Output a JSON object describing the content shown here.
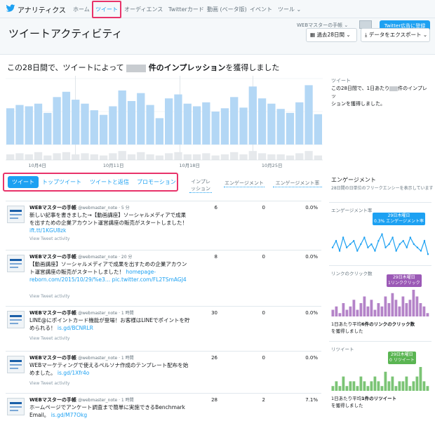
{
  "nav": {
    "app_name": "アナリティクス",
    "items": [
      "ホーム",
      "ツイート",
      "オーディエンス",
      "Twitterカード",
      "動画 (ベータ版)",
      "イベント",
      "ツール"
    ],
    "active": "ツイート"
  },
  "header": {
    "title": "ツイートアクティビティ",
    "account": "WEBマスターの手帳",
    "ads_button": "Twitter広告に登録",
    "date_range": "過去28日間",
    "export_button": "データをエクスポート"
  },
  "headline": {
    "prefix": "この28日間で、ツイートによって",
    "suffix_bold": "件のインプレッション",
    "suffix": "を獲得しました"
  },
  "sidebar_tweets": {
    "label": "ツイート",
    "line1": "この28日間で、1日あたり",
    "line1b": "件のインプレッ",
    "line2": "ションを獲得しました。"
  },
  "chart_data": {
    "type": "bar",
    "x_tick_labels": [
      "10月4日",
      "10月11日",
      "10月18日",
      "10月25日"
    ],
    "values": [
      55,
      60,
      58,
      62,
      48,
      72,
      80,
      68,
      62,
      52,
      45,
      58,
      82,
      66,
      78,
      60,
      40,
      70,
      76,
      62,
      58,
      64,
      50,
      55,
      72,
      56,
      88,
      70,
      62,
      54,
      48,
      64,
      90,
      46
    ],
    "secondary_values": [
      10,
      12,
      10,
      14,
      8,
      12,
      14,
      10,
      12,
      10,
      8,
      12,
      16,
      10,
      14,
      10,
      8,
      12,
      14,
      10,
      10,
      12,
      8,
      10,
      14,
      10,
      16,
      12,
      10,
      10,
      8,
      12,
      16,
      8
    ],
    "bar_color": "#b3d7f5",
    "secondary_color": "#e6e9ec"
  },
  "tabs": [
    "ツイート",
    "トップツイート",
    "ツイートと返信",
    "プロモーション"
  ],
  "columns": [
    "インプレ\nッション",
    "エンゲージメント",
    "エンゲージメント率"
  ],
  "view_activity_label": "View Tweet activity",
  "tweets": [
    {
      "name": "WEBマスターの手帳",
      "handle": "@webmaster_note · 5 分",
      "text": "新しい記事を書きました→【動画講座】ソーシャルメディアで成果を出すための企業アカウント運営講座の販売がスタートしました！",
      "link": "ift.tt/1KGU8zk",
      "impressions": "6",
      "engagements": "0",
      "rate": "0.0%"
    },
    {
      "name": "WEBマスターの手帳",
      "handle": "@webmaster_note · 20 分",
      "text": "【動画講座】ソーシャルメディアで成果を出すための企業アカウント運営講座の販売がスタートしました！",
      "link": "homepage-reborn.com/2015/10/29/%e3… pic.twitter.com/FL2TSmAGJ4",
      "impressions": "8",
      "engagements": "0",
      "rate": "0.0%"
    },
    {
      "name": "WEBマスターの手帳",
      "handle": "@webmaster_note · 1 時間",
      "text": "LINE@にポイントカード機能が登場！お客様はLINEでポイントを貯められる！",
      "link": "is.gd/BCNRLR",
      "impressions": "30",
      "engagements": "0",
      "rate": "0.0%"
    },
    {
      "name": "WEBマスターの手帳",
      "handle": "@webmaster_note · 1 時間",
      "text": "WEBマーケティングで使えるペルソナ作成のテンプレート配布を始めました。",
      "link": "is.gd/1Xfr4o",
      "impressions": "26",
      "engagements": "0",
      "rate": "0.0%"
    },
    {
      "name": "WEBマスターの手帳",
      "handle": "@webmaster_note · 1 時間",
      "text": "ホームページでアンケート調査まで簡単に実施できるBenchmark Email。",
      "link": "is.gd/M77Okg",
      "impressions": "28",
      "engagements": "2",
      "rate": "7.1%"
    }
  ],
  "engagement_panel": {
    "title": "エンゲージメント",
    "subtitle": "28日間の日単位のフリークエンシーを表示しています",
    "rate_label": "エンゲージメント率",
    "rate_date": "29日木曜日",
    "rate_value": "0.3% エンゲージメント率",
    "rate_color": "#1da1f2",
    "rate_values": [
      3,
      5,
      2,
      6,
      3,
      4,
      5,
      2,
      4,
      6,
      3,
      4,
      2,
      5,
      7,
      3,
      4,
      6,
      2,
      4,
      5,
      3,
      6,
      4,
      3,
      2,
      5,
      1
    ],
    "clicks_label": "リンクのクリック数",
    "clicks_date": "29日木曜日",
    "clicks_value": "1リンククリック",
    "clicks_color": "#9b59b6",
    "clicks_values": [
      2,
      3,
      1,
      4,
      2,
      3,
      5,
      2,
      4,
      6,
      3,
      5,
      2,
      4,
      3,
      6,
      4,
      7,
      5,
      3,
      6,
      4,
      5,
      8,
      6,
      4,
      3,
      1
    ],
    "clicks_footer_a": "1日あたり平均",
    "clicks_footer_b": "6件のリンクのクリック数",
    "clicks_footer_c": "を獲得しました",
    "retweets_label": "リツイート",
    "retweets_date": "29日木曜日",
    "retweets_value": "0 リツイート",
    "retweets_color": "#5ab552",
    "retweets_values": [
      1,
      2,
      1,
      3,
      1,
      2,
      2,
      1,
      3,
      2,
      1,
      2,
      3,
      2,
      1,
      4,
      2,
      3,
      1,
      2,
      2,
      3,
      1,
      2,
      3,
      5,
      2,
      1
    ],
    "retweets_footer_a": "1日あたり平均",
    "retweets_footer_b": "1件のリツイート",
    "retweets_footer_c": "を獲得しました"
  }
}
